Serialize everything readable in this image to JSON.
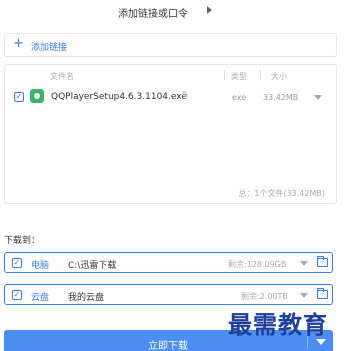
{
  "header": {
    "title": "添加链接或口令"
  },
  "add_link": {
    "plus": "+",
    "label": "添加链接"
  },
  "file_list": {
    "columns": {
      "name": "文件名",
      "type": "类型",
      "size": "大小"
    },
    "rows": [
      {
        "checked": "✓",
        "name": "QQPlayerSetup4.6.3.1104.exe",
        "type": "exe",
        "size": "33.42MB"
      }
    ],
    "summary": "总：1个文件(33.42MB)"
  },
  "download_to": {
    "label": "下载到：",
    "targets": [
      {
        "checked": "✓",
        "kind": "电脑",
        "path": "C:\\迅雷下载",
        "free": "剩余:128.09GB"
      },
      {
        "checked": "✓",
        "kind": "云盘",
        "path": "我的云盘",
        "free": "剩余:2.00TB"
      }
    ]
  },
  "download_button": {
    "label": "立即下载"
  },
  "watermark": "最需教育",
  "colors": {
    "accent": "#3a7ee8",
    "button": "#4b8ef0",
    "file_icon": "#3bb36b",
    "watermark": "#1f3f9a"
  }
}
